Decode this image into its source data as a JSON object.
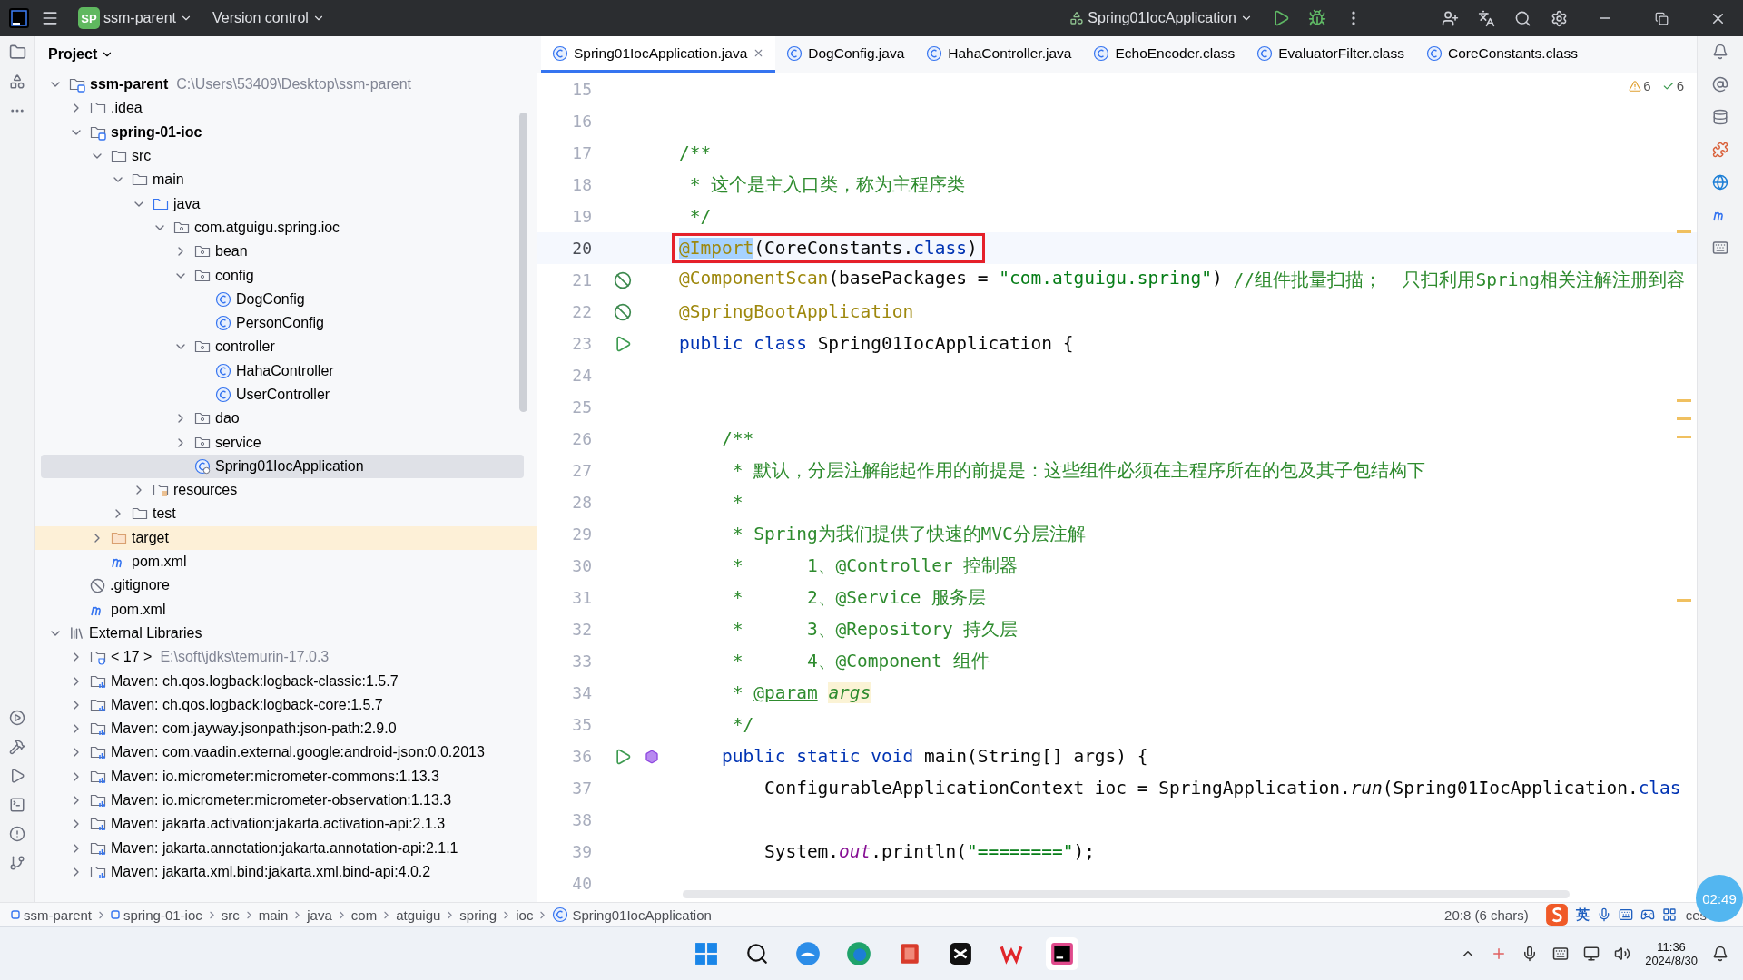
{
  "title_bar": {
    "project_badge": "SP",
    "project": "ssm-parent",
    "vcs": "Version control",
    "run_config": "Spring01IocApplication"
  },
  "project_panel": {
    "title": "Project",
    "tree": [
      {
        "label": "ssm-parent",
        "kind": "module",
        "bold": true,
        "hint": "C:\\Users\\53409\\Desktop\\ssm-parent",
        "expanded": true,
        "selected": false,
        "children": [
          {
            "label": ".idea",
            "kind": "folder",
            "expanded": false,
            "selected": false
          },
          {
            "label": "spring-01-ioc",
            "kind": "module",
            "bold": true,
            "expanded": true,
            "selected": false,
            "children": [
              {
                "label": "src",
                "kind": "folder",
                "expanded": true,
                "selected": false,
                "children": [
                  {
                    "label": "main",
                    "kind": "folder",
                    "expanded": true,
                    "selected": false,
                    "children": [
                      {
                        "label": "java",
                        "kind": "source",
                        "expanded": true,
                        "selected": false,
                        "children": [
                          {
                            "label": "com.atguigu.spring.ioc",
                            "kind": "package",
                            "expanded": true,
                            "selected": false,
                            "children": [
                              {
                                "label": "bean",
                                "kind": "package",
                                "expanded": false,
                                "selected": false
                              },
                              {
                                "label": "config",
                                "kind": "package",
                                "expanded": true,
                                "selected": false,
                                "children": [
                                  {
                                    "label": "DogConfig",
                                    "kind": "class",
                                    "selected": false
                                  },
                                  {
                                    "label": "PersonConfig",
                                    "kind": "class",
                                    "selected": false
                                  }
                                ]
                              },
                              {
                                "label": "controller",
                                "kind": "package",
                                "expanded": true,
                                "selected": false,
                                "children": [
                                  {
                                    "label": "HahaController",
                                    "kind": "class",
                                    "selected": false
                                  },
                                  {
                                    "label": "UserController",
                                    "kind": "class",
                                    "selected": false
                                  }
                                ]
                              },
                              {
                                "label": "dao",
                                "kind": "package",
                                "expanded": false,
                                "selected": false
                              },
                              {
                                "label": "service",
                                "kind": "package",
                                "expanded": false,
                                "selected": false
                              },
                              {
                                "label": "Spring01IocApplication",
                                "kind": "app-class",
                                "selected": true
                              }
                            ]
                          }
                        ]
                      },
                      {
                        "label": "resources",
                        "kind": "resources",
                        "expanded": false,
                        "selected": false
                      }
                    ]
                  },
                  {
                    "label": "test",
                    "kind": "folder",
                    "expanded": false,
                    "selected": false
                  }
                ]
              },
              {
                "label": "target",
                "kind": "excluded",
                "expanded": false,
                "selected": false
              },
              {
                "label": "pom.xml",
                "kind": "maven-file",
                "selected": false
              }
            ]
          },
          {
            "label": ".gitignore",
            "kind": "ignore-file",
            "selected": false
          },
          {
            "label": "pom.xml",
            "kind": "maven-file",
            "selected": false
          }
        ]
      },
      {
        "label": "External Libraries",
        "kind": "libraries",
        "expanded": true,
        "selected": false,
        "children": [
          {
            "label": "< 17 >",
            "kind": "jdk",
            "hint": "E:\\soft\\jdks\\temurin-17.0.3",
            "expanded": false,
            "selected": false
          },
          {
            "label": "Maven: ch.qos.logback:logback-classic:1.5.7",
            "kind": "library",
            "expanded": false,
            "selected": false
          },
          {
            "label": "Maven: ch.qos.logback:logback-core:1.5.7",
            "kind": "library",
            "expanded": false,
            "selected": false
          },
          {
            "label": "Maven: com.jayway.jsonpath:json-path:2.9.0",
            "kind": "library",
            "expanded": false,
            "selected": false
          },
          {
            "label": "Maven: com.vaadin.external.google:android-json:0.0.2013",
            "kind": "library",
            "expanded": false,
            "selected": false
          },
          {
            "label": "Maven: io.micrometer:micrometer-commons:1.13.3",
            "kind": "library",
            "expanded": false,
            "selected": false
          },
          {
            "label": "Maven: io.micrometer:micrometer-observation:1.13.3",
            "kind": "library",
            "expanded": false,
            "selected": false
          },
          {
            "label": "Maven: jakarta.activation:jakarta.activation-api:2.1.3",
            "kind": "library",
            "expanded": false,
            "selected": false
          },
          {
            "label": "Maven: jakarta.annotation:jakarta.annotation-api:2.1.1",
            "kind": "library",
            "expanded": false,
            "selected": false
          },
          {
            "label": "Maven: jakarta.xml.bind:jakarta.xml.bind-api:4.0.2",
            "kind": "library",
            "expanded": false,
            "selected": false
          }
        ]
      }
    ]
  },
  "editor": {
    "tabs": [
      {
        "label": "Spring01IocApplication.java",
        "selected": true,
        "closable": true
      },
      {
        "label": "DogConfig.java",
        "selected": false,
        "closable": false
      },
      {
        "label": "HahaController.java",
        "selected": false,
        "closable": false
      },
      {
        "label": "EchoEncoder.class",
        "selected": false,
        "closable": false
      },
      {
        "label": "EvaluatorFilter.class",
        "selected": false,
        "closable": false
      },
      {
        "label": "CoreConstants.class",
        "selected": false,
        "closable": false
      }
    ],
    "inspections": [
      {
        "kind": "warning",
        "count": "6"
      },
      {
        "kind": "ok",
        "count": "6"
      }
    ],
    "lines": [
      {
        "number": "15",
        "current": false
      },
      {
        "number": "16",
        "current": false
      },
      {
        "number": "17",
        "current": false,
        "boxed": false,
        "tokens": [
          {
            "kind": "comment",
            "text": "/**"
          }
        ]
      },
      {
        "number": "18",
        "current": false,
        "boxed": false,
        "tokens": [
          {
            "kind": "comment",
            "text": " * 这个是主入口类，称为主程序类"
          }
        ]
      },
      {
        "number": "19",
        "current": false,
        "boxed": false,
        "tokens": [
          {
            "kind": "comment",
            "text": " */"
          }
        ]
      },
      {
        "number": "20",
        "current": true,
        "boxed": true,
        "tokens": [
          {
            "kind": "selected-annotation",
            "text": "@Import"
          },
          {
            "kind": "plain",
            "text": "(CoreConstants."
          },
          {
            "kind": "keyword",
            "text": "class"
          },
          {
            "kind": "plain",
            "text": ")"
          }
        ]
      },
      {
        "number": "21",
        "current": false,
        "boxed": false,
        "gutter": [
          {
            "kind": "bean"
          }
        ],
        "tokens": [
          {
            "kind": "annotation",
            "text": "@ComponentScan"
          },
          {
            "kind": "plain",
            "text": "(basePackages = "
          },
          {
            "kind": "string",
            "text": "\"com.atguigu.spring\""
          },
          {
            "kind": "plain",
            "text": ") "
          },
          {
            "kind": "comment",
            "text": "//组件批量扫描；  只扫利用Spring相关注解注册到容"
          }
        ]
      },
      {
        "number": "22",
        "current": false,
        "boxed": false,
        "gutter": [
          {
            "kind": "bean"
          }
        ],
        "tokens": [
          {
            "kind": "annotation",
            "text": "@SpringBootApplication"
          }
        ]
      },
      {
        "number": "23",
        "current": false,
        "boxed": false,
        "gutter": [
          {
            "kind": "run"
          }
        ],
        "tokens": [
          {
            "kind": "keyword",
            "text": "public class "
          },
          {
            "kind": "plain",
            "text": "Spring01IocApplication {"
          }
        ]
      },
      {
        "number": "24",
        "current": false
      },
      {
        "number": "25",
        "current": false
      },
      {
        "number": "26",
        "current": false,
        "boxed": false,
        "tokens": [
          {
            "kind": "comment",
            "text": "    /**"
          }
        ]
      },
      {
        "number": "27",
        "current": false,
        "boxed": false,
        "tokens": [
          {
            "kind": "comment",
            "text": "     * 默认，分层注解能起作用的前提是：这些组件必须在主程序所在的包及其子包结构下"
          }
        ]
      },
      {
        "number": "28",
        "current": false,
        "boxed": false,
        "tokens": [
          {
            "kind": "comment",
            "text": "     *"
          }
        ]
      },
      {
        "number": "29",
        "current": false,
        "boxed": false,
        "tokens": [
          {
            "kind": "comment",
            "text": "     * Spring为我们提供了快速的MVC分层注解"
          }
        ]
      },
      {
        "number": "30",
        "current": false,
        "boxed": false,
        "tokens": [
          {
            "kind": "comment",
            "text": "     *      1、@Controller 控制器"
          }
        ]
      },
      {
        "number": "31",
        "current": false,
        "boxed": false,
        "tokens": [
          {
            "kind": "comment",
            "text": "     *      2、@Service 服务层"
          }
        ]
      },
      {
        "number": "32",
        "current": false,
        "boxed": false,
        "tokens": [
          {
            "kind": "comment",
            "text": "     *      3、@Repository 持久层"
          }
        ]
      },
      {
        "number": "33",
        "current": false,
        "boxed": false,
        "tokens": [
          {
            "kind": "comment",
            "text": "     *      4、@Component 组件"
          }
        ]
      },
      {
        "number": "34",
        "current": false,
        "boxed": false,
        "tokens": [
          {
            "kind": "comment",
            "text": "     * "
          },
          {
            "kind": "doc-tag",
            "text": "@param"
          },
          {
            "kind": "param-ref",
            "text": "args"
          }
        ]
      },
      {
        "number": "35",
        "current": false,
        "boxed": false,
        "tokens": [
          {
            "kind": "comment",
            "text": "     */"
          }
        ]
      },
      {
        "number": "36",
        "current": false,
        "boxed": false,
        "gutter": [
          {
            "kind": "run"
          },
          {
            "kind": "override"
          }
        ],
        "tokens": [
          {
            "kind": "keyword",
            "text": "    public static void "
          },
          {
            "kind": "plain",
            "text": "main(String[] args) {"
          }
        ]
      },
      {
        "number": "37",
        "current": false,
        "boxed": false,
        "tokens": [
          {
            "kind": "plain",
            "text": "        ConfigurableApplicationContext ioc = SpringApplication."
          },
          {
            "kind": "static-method",
            "text": "run"
          },
          {
            "kind": "plain",
            "text": "(Spring01IocApplication."
          },
          {
            "kind": "keyword",
            "text": "clas"
          }
        ]
      },
      {
        "number": "38",
        "current": false
      },
      {
        "number": "39",
        "current": false,
        "boxed": false,
        "tokens": [
          {
            "kind": "plain",
            "text": "        System."
          },
          {
            "kind": "static-field",
            "text": "out"
          },
          {
            "kind": "plain",
            "text": ".println("
          },
          {
            "kind": "string",
            "text": "\"========\""
          },
          {
            "kind": "plain",
            "text": ");"
          }
        ]
      },
      {
        "number": "40",
        "current": false
      }
    ]
  },
  "status_bar": {
    "breadcrumbs": [
      {
        "label": "ssm-parent",
        "kind": "module"
      },
      {
        "label": "spring-01-ioc",
        "kind": "module"
      },
      {
        "label": "src",
        "kind": "plain"
      },
      {
        "label": "main",
        "kind": "plain"
      },
      {
        "label": "java",
        "kind": "plain"
      },
      {
        "label": "com",
        "kind": "plain"
      },
      {
        "label": "atguigu",
        "kind": "plain"
      },
      {
        "label": "spring",
        "kind": "plain"
      },
      {
        "label": "ioc",
        "kind": "plain"
      },
      {
        "label": "Spring01IocApplication",
        "kind": "class"
      }
    ],
    "position": "20:8 (6 chars)",
    "ime_mode": "英",
    "trailing": "ces"
  },
  "recording_timer": "02:49",
  "taskbar": {
    "time": "11:36",
    "date": "2024/8/30"
  }
}
